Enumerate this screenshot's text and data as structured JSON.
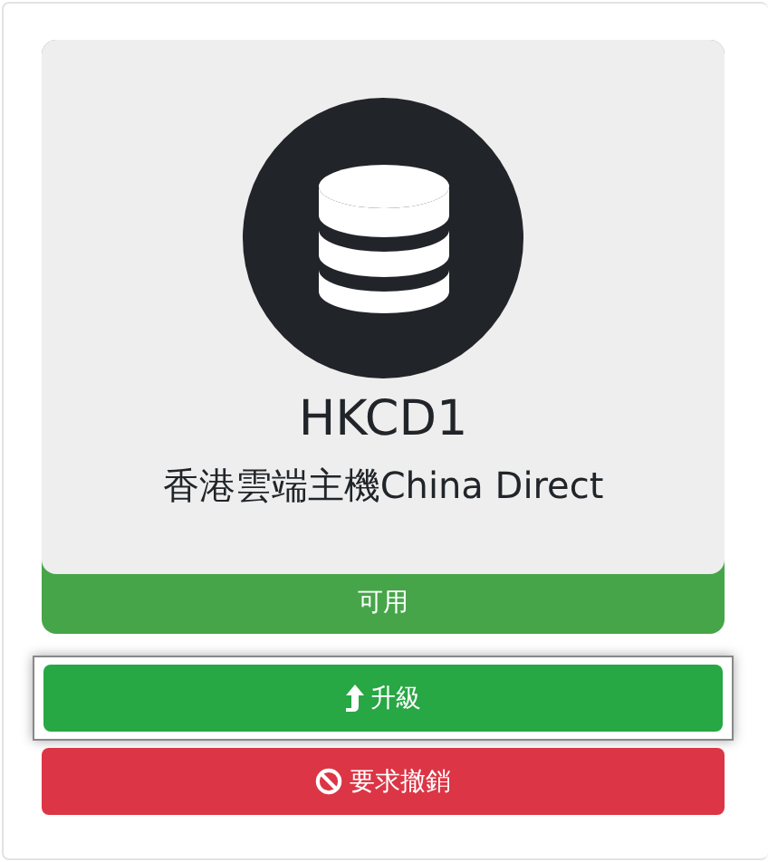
{
  "service": {
    "name": "HKCD1",
    "product": "香港雲端主機China Direct",
    "status": "可用"
  },
  "buttons": [
    {
      "kind": "upgrade",
      "label": "升級",
      "focused": true
    },
    {
      "kind": "cancel",
      "label": "要求撤銷",
      "focused": false
    }
  ]
}
